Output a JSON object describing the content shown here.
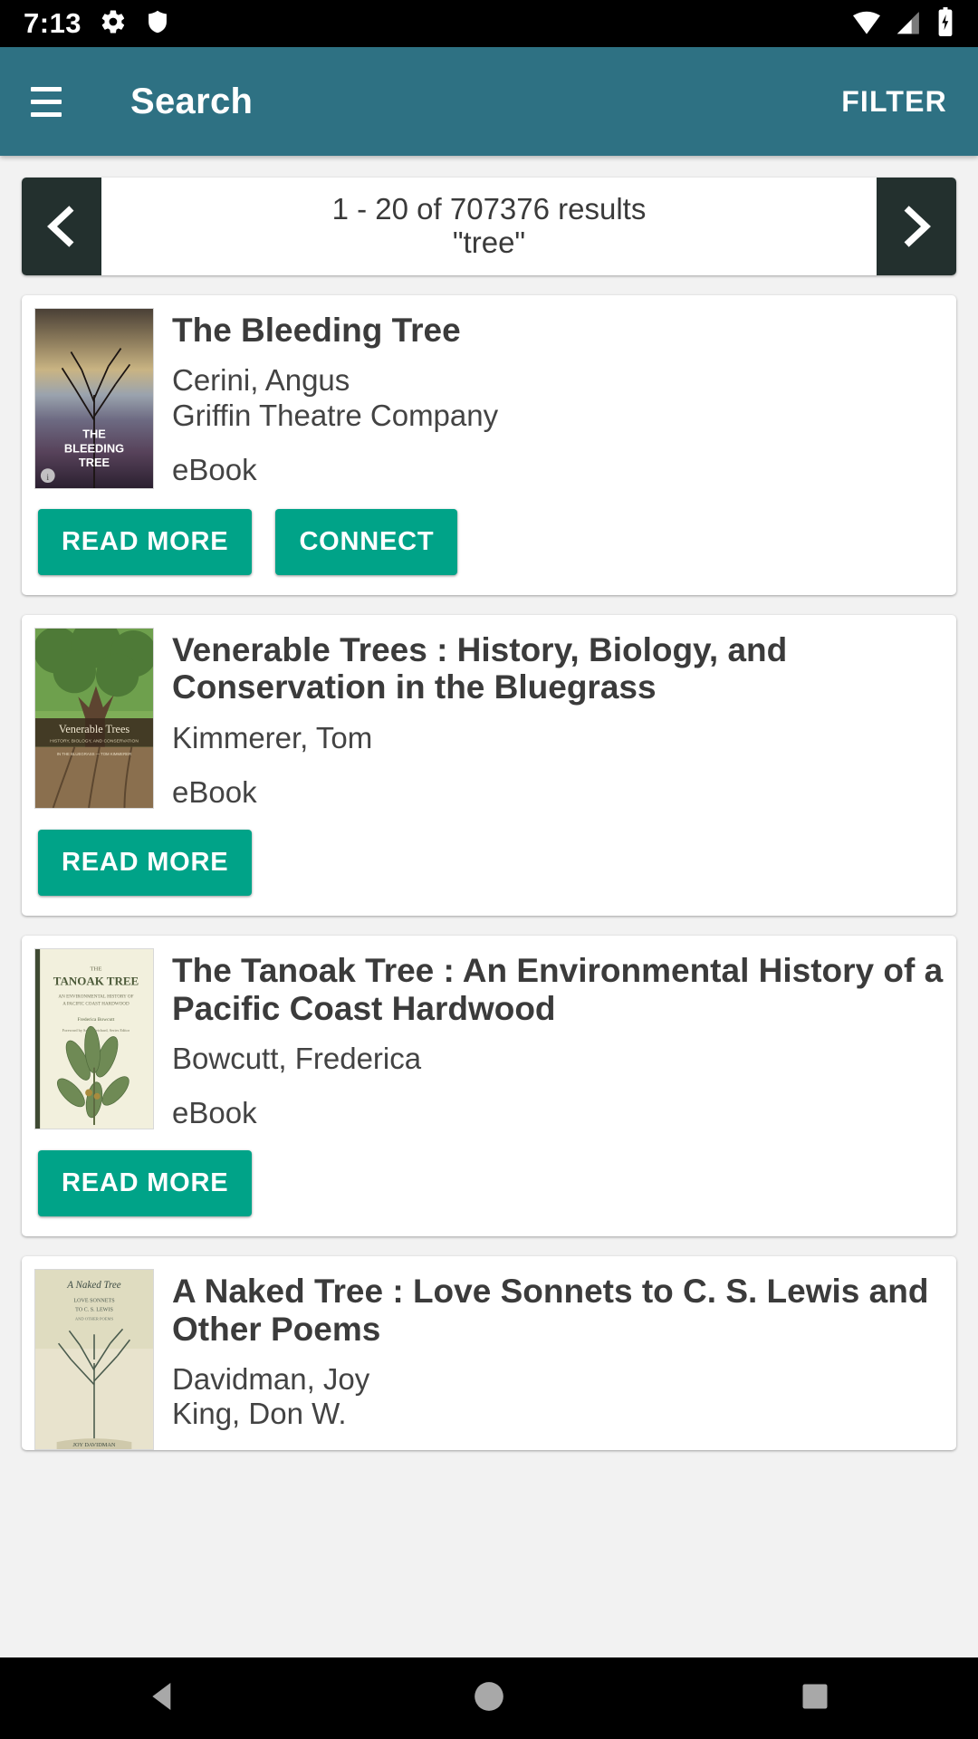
{
  "status_bar": {
    "time": "7:13",
    "left_icons": [
      "gear-icon",
      "shield-icon"
    ],
    "right_icons": [
      "wifi-icon",
      "cellular-signal-icon",
      "battery-charging-icon"
    ]
  },
  "app_bar": {
    "menu_icon": "hamburger-menu-icon",
    "title": "Search",
    "action_label": "FILTER",
    "background_color": "#2E7183"
  },
  "pagination": {
    "prev_icon": "chevron-left-icon",
    "next_icon": "chevron-right-icon",
    "results_text": "1 - 20 of 707376 results",
    "query_text": "\"tree\""
  },
  "results": [
    {
      "title": "The Bleeding Tree",
      "lines": [
        "Cerini, Angus",
        "Griffin Theatre Company"
      ],
      "format": "eBook",
      "cover_name": "cover-the-bleeding-tree",
      "buttons": [
        "READ MORE",
        "CONNECT"
      ]
    },
    {
      "title": "Venerable Trees : History, Biology, and Conservation in the Bluegrass",
      "lines": [
        "Kimmerer, Tom"
      ],
      "format": "eBook",
      "cover_name": "cover-venerable-trees",
      "buttons": [
        "READ MORE"
      ]
    },
    {
      "title": "The Tanoak Tree : An Environmental History of a Pacific Coast Hardwood",
      "lines": [
        "Bowcutt, Frederica"
      ],
      "format": "eBook",
      "cover_name": "cover-the-tanoak-tree",
      "buttons": [
        "READ MORE"
      ]
    },
    {
      "title": "A Naked Tree : Love Sonnets to C. S. Lewis and Other Poems",
      "lines": [
        "Davidman, Joy",
        "King, Don W."
      ],
      "format": "",
      "cover_name": "cover-a-naked-tree",
      "buttons": []
    }
  ],
  "nav_bar": {
    "back_icon": "back-triangle-icon",
    "home_icon": "home-circle-icon",
    "recents_icon": "recents-square-icon"
  },
  "colors": {
    "accent_teal": "#2E7183",
    "button_green": "#00A388",
    "pager_button": "#23302E",
    "page_background": "#F2F2F2"
  }
}
